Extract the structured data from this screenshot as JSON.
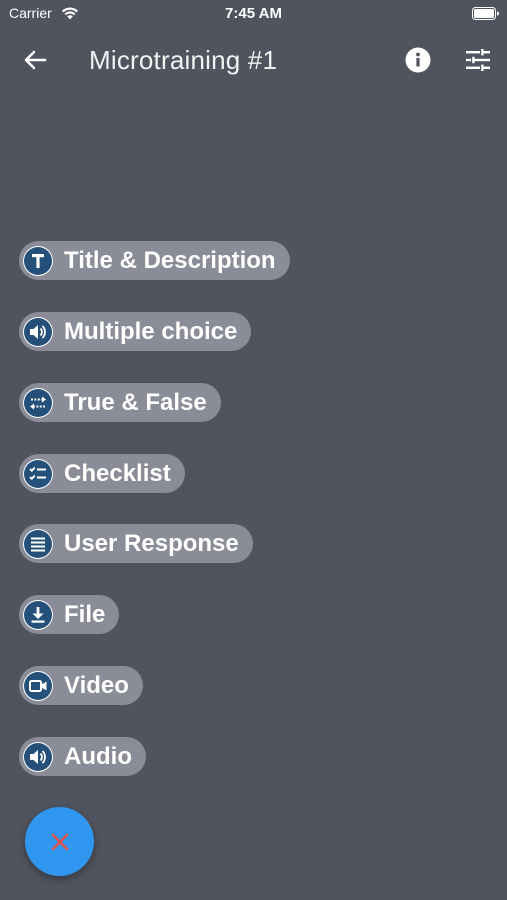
{
  "status_bar": {
    "carrier": "Carrier",
    "time": "7:45 AM"
  },
  "app_bar": {
    "title": "Microtraining #1",
    "back_icon": "arrow-left-icon",
    "info_icon": "info-icon",
    "settings_icon": "tune-sliders-icon"
  },
  "speed_dial": {
    "items": [
      {
        "label": "Title & Description",
        "icon": "title-t-icon"
      },
      {
        "label": "Multiple choice",
        "icon": "speaker-icon"
      },
      {
        "label": "True & False",
        "icon": "swap-arrows-icon"
      },
      {
        "label": "Checklist",
        "icon": "checklist-icon"
      },
      {
        "label": "User Response",
        "icon": "text-lines-icon"
      },
      {
        "label": "File",
        "icon": "download-icon"
      },
      {
        "label": "Video",
        "icon": "video-camera-icon"
      },
      {
        "label": "Audio",
        "icon": "speaker-icon"
      }
    ],
    "fab_icon": "close-icon"
  },
  "colors": {
    "background": "#50545e",
    "chip_background": "#8a8d97",
    "icon_color": "#24507a",
    "fab_background": "#2f97f0",
    "fab_icon_color": "#e0524a"
  }
}
